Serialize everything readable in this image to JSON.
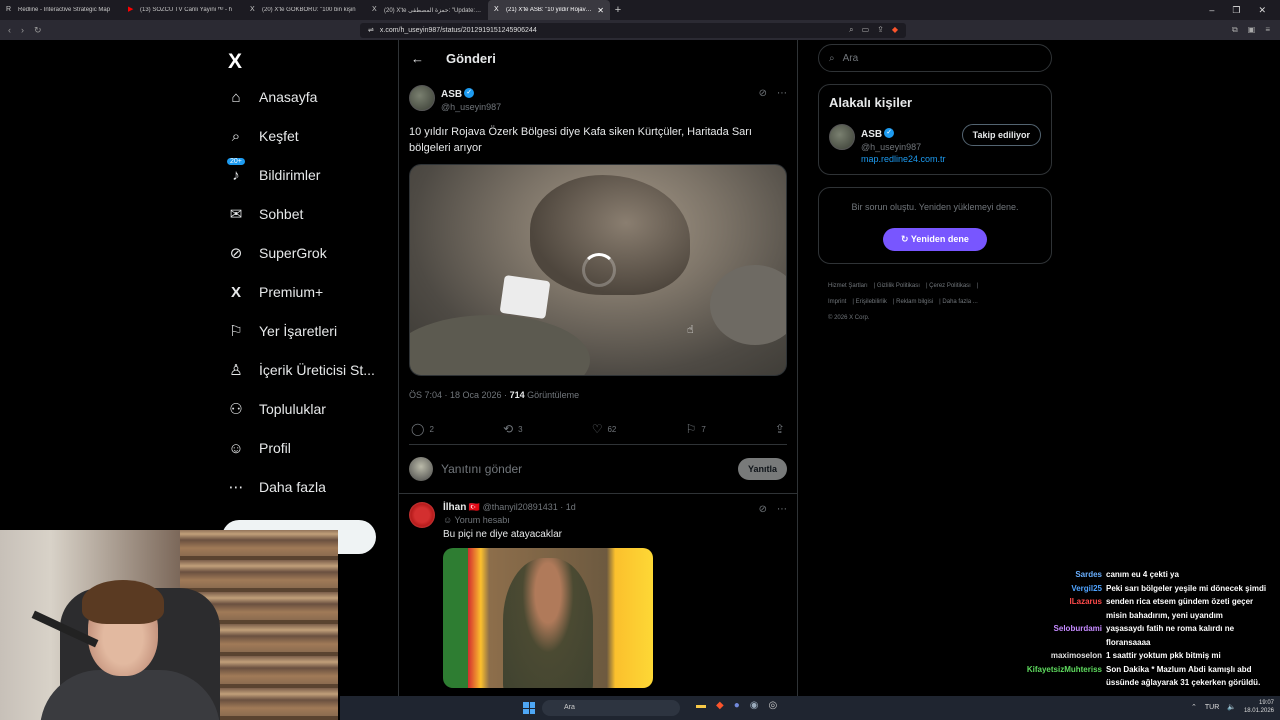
{
  "browser": {
    "tabs": [
      {
        "label": "Redline - Interactive Strategic Map",
        "icon": "R",
        "active": false
      },
      {
        "label": "(13) SÖZCÜ TV Canlı Yayını ᴴᴰ - h",
        "icon": "▶",
        "active": false
      },
      {
        "label": "(20) X'te GÖKBÖRÜ: \"100 bin kişin",
        "icon": "X",
        "active": false
      },
      {
        "label": "(20) X'te حمزة المصطفى: \"Update: Bo",
        "icon": "X",
        "active": false
      },
      {
        "label": "(21) X'te ASB: \"10 yıldır Rojava Ö",
        "icon": "X",
        "active": true
      }
    ],
    "new_tab": "+",
    "url": "x.com/h_useyin987/status/2012919151245906244"
  },
  "nav": {
    "logo": "X",
    "items": [
      {
        "label": "Anasayfa",
        "icon": "⌂"
      },
      {
        "label": "Keşfet",
        "icon": "⌕"
      },
      {
        "label": "Bildirimler",
        "icon": "🔔"
      },
      {
        "label": "Sohbet",
        "icon": "✉"
      },
      {
        "label": "SuperGrok",
        "icon": "⊘"
      },
      {
        "label": "Premium+",
        "icon": "X"
      },
      {
        "label": "Yer İşaretleri",
        "icon": "🔖"
      },
      {
        "label": "İçerik Üreticisi St...",
        "icon": "♙"
      },
      {
        "label": "Topluluklar",
        "icon": "👥"
      },
      {
        "label": "Profil",
        "icon": "♙"
      },
      {
        "label": "Daha fazla",
        "icon": "⋯"
      }
    ],
    "notif_badge": "20+"
  },
  "post": {
    "header_title": "Gönderi",
    "author_name": "ASB",
    "author_handle": "@h_useyin987",
    "text": "10 yıldır Rojava Özerk Bölgesi diye Kafa siken Kürtçüler, Haritada Sarı bölgeleri arıyor",
    "time": "ÖS 7:04 · 18 Oca 2026 · ",
    "views": "714",
    "views_label": " Görüntüleme",
    "replies": "2",
    "reposts": "3",
    "likes": "62",
    "bookmarks": "7",
    "reply_placeholder": "Yanıtını gönder",
    "reply_button": "Yanıtla"
  },
  "comment": {
    "name": "İlhan",
    "flag": "🇹🇷",
    "handle_time": "@thanyil20891431 · 1d",
    "sub": "Yorum hesabı",
    "text": "Bu piçi ne diye atayacaklar"
  },
  "sidebar": {
    "search_placeholder": "Ara",
    "related_title": "Alakalı kişiler",
    "person_name": "ASB",
    "person_handle": "@h_useyin987",
    "person_link": "map.redline24.com.tr",
    "follow_label": "Takip ediliyor",
    "error_text": "Bir sorun oluştu. Yeniden yüklemeyi dene.",
    "retry_label": "Yeniden dene",
    "footer_links": [
      "Hizmet Şartları",
      "Gizlilik Politikası",
      "Çerez Politikası",
      "Imprint",
      "Erişilebilirlik",
      "Reklam bilgisi",
      "Daha fazla ..."
    ],
    "copyright": "© 2026 X Corp."
  },
  "chat": [
    {
      "user": "Sardes",
      "color": "#6ab0ff",
      "text": "canım eu 4 çekti ya"
    },
    {
      "user": "Vergil25",
      "color": "#4fa3ff",
      "text": "Peki sarı bölgeler yeşile mi dönecek şimdi"
    },
    {
      "user": "ILazarus",
      "color": "#ff4a4a",
      "text": "senden rica etsem gündem özeti geçer misin bahadırım, yeni uyandım"
    },
    {
      "user": "Seloburdami",
      "color": "#c58aff",
      "text": "yaşasaydı fatih ne roma kalırdı ne floransaaaa"
    },
    {
      "user": "maximoselon",
      "color": "#e0e0e0",
      "text": "1 saattir yoktum pkk bitmiş mi"
    },
    {
      "user": "KifayetsizMuhteriss",
      "color": "#5fdc5f",
      "text": "Son Dakika * Mazlum Abdi kamışlı abd üssünde ağlayarak 31 çekerken görüldü."
    }
  ],
  "taskbar": {
    "search": "Ara",
    "lang": "TUR",
    "time": "19:07",
    "date": "18.01.2026"
  }
}
